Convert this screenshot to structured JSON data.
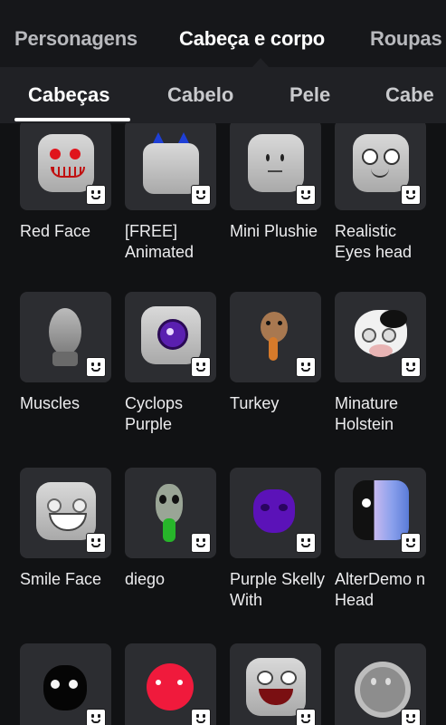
{
  "top_tabs": [
    {
      "label": "Personagens",
      "active": false
    },
    {
      "label": "Cabeça e corpo",
      "active": true
    },
    {
      "label": "Roupas",
      "active": false
    }
  ],
  "sub_tabs": [
    {
      "label": "Cabeças",
      "active": true
    },
    {
      "label": "Cabelo",
      "active": false
    },
    {
      "label": "Pele",
      "active": false
    },
    {
      "label": "Cabe",
      "active": false
    }
  ],
  "items": [
    {
      "name": "Red Face",
      "icon": "red-face-head-icon"
    },
    {
      "name": "[FREE] Animated",
      "icon": "animated-cat-ears-head-icon"
    },
    {
      "name": "Mini Plushie",
      "icon": "plushie-head-icon"
    },
    {
      "name": "Realistic Eyes head",
      "icon": "realistic-eyes-head-icon"
    },
    {
      "name": "Muscles",
      "icon": "muscles-head-icon"
    },
    {
      "name": "Cyclops Purple",
      "icon": "cyclops-head-icon"
    },
    {
      "name": "Turkey",
      "icon": "turkey-head-icon"
    },
    {
      "name": "Minature Holstein",
      "icon": "cow-head-icon"
    },
    {
      "name": "Smile Face",
      "icon": "smile-face-head-icon"
    },
    {
      "name": "diego",
      "icon": "alien-head-icon"
    },
    {
      "name": "Purple Skelly With",
      "icon": "purple-skull-head-icon"
    },
    {
      "name": "AlterDemo n Head",
      "icon": "alterdemon-head-icon"
    },
    {
      "name": "",
      "icon": "black-skull-head-icon"
    },
    {
      "name": "",
      "icon": "red-round-head-icon"
    },
    {
      "name": "",
      "icon": "grin-head-icon"
    },
    {
      "name": "",
      "icon": "smiley-ring-head-icon"
    }
  ]
}
